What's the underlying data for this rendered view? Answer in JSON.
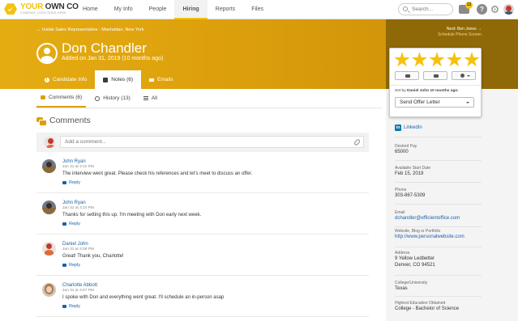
{
  "app": {
    "logo_title_a": "YOUR",
    "logo_title_b": " OWN CO",
    "logo_subtitle": "COMPANY LOGO GOES HERE"
  },
  "nav": {
    "items": [
      {
        "label": "Home"
      },
      {
        "label": "My Info"
      },
      {
        "label": "People"
      },
      {
        "label": "Hiring"
      },
      {
        "label": "Reports"
      },
      {
        "label": "Files"
      }
    ],
    "active": "Hiring",
    "search_placeholder": "Search...",
    "inbox_count": "12",
    "help_label": "?"
  },
  "banner": {
    "breadcrumb": "← Inside Sales Representative - Manhattan, New York",
    "next_label": "Next: Ben Jones →",
    "next_sub": "Schedule Phone Screen",
    "candidate_name": "Don Chandler",
    "added": "Added on Jan 31, 2019 (10 months ago)",
    "tabs": [
      {
        "label": "Candidate Info"
      },
      {
        "label": "Notes (6)"
      },
      {
        "label": "Emails"
      }
    ]
  },
  "subtabs": [
    {
      "label": "Comments (6)"
    },
    {
      "label": "History (13)"
    },
    {
      "label": "All"
    }
  ],
  "comments_title": "Comments",
  "composer_placeholder": "Add a comment...",
  "comments": [
    {
      "author": "John Ryan",
      "time": "Jan 31 at 4:10 PM",
      "text": "The interview went great. Please check his references and let's meet to discuss an offer.",
      "reply": "Reply"
    },
    {
      "author": "John Ryan",
      "time": "Jan 31 at 4:10 PM",
      "text": "Thanks for setting this up. I'm meeting with Don early next week.",
      "reply": "Reply"
    },
    {
      "author": "Daniel John",
      "time": "Jan 31 at 4:08 PM",
      "text": "Great! Thank you, Charlotte!",
      "reply": "Reply"
    },
    {
      "author": "Charlotte Abbott",
      "time": "Jan 31 at 4:07 PM",
      "text": "I spoke with Don and everything went great. I'll schedule an in-person asap",
      "reply": "Reply"
    }
  ],
  "rating": {
    "stars": 5,
    "max_stars": 5,
    "set_by_prefix": "Set by ",
    "set_by": "Daniel John 10 months ago:",
    "status": "Send Offer Letter"
  },
  "details": {
    "linkedin": "LinkedIn",
    "li_glyph": "in",
    "fields": [
      {
        "label": "Desired Pay",
        "value": "65000"
      },
      {
        "label": "Available Start Date",
        "value": "Feb 15, 2019"
      },
      {
        "label": "Phone",
        "value": "303-867-5309"
      },
      {
        "label": "Email",
        "value": "dchandler@efficientoffice.com"
      },
      {
        "label": "Website, Blog or Portfolio",
        "value": "http://www.personalwebsite.com"
      },
      {
        "label": "Address",
        "value": "9 Yellow Ledbetter"
      },
      {
        "label": "",
        "value": "Denver, CO 94521"
      },
      {
        "label": "College/University",
        "value": "Texas"
      },
      {
        "label": "Highest Education Obtained",
        "value": "College - Bachelor of Science"
      }
    ]
  },
  "colors": {
    "brand": "#f4c20d",
    "banner": "#dc9f0c",
    "banner_dark": "#8f6808",
    "link": "#1a62a8"
  }
}
